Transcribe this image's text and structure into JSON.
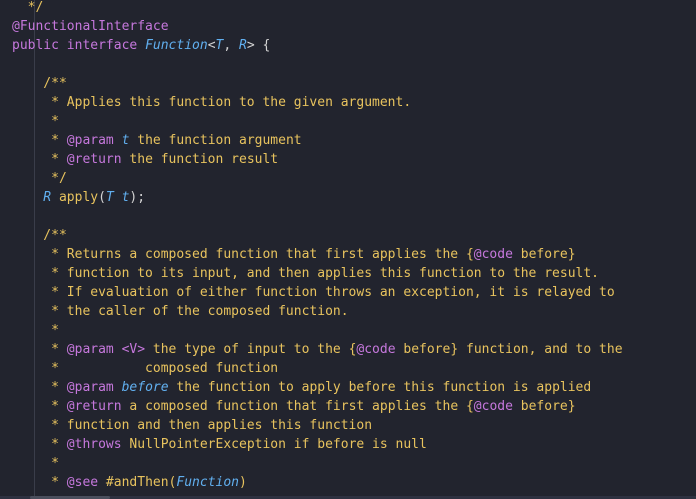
{
  "lines": [
    {
      "segs": [
        {
          "c": "comment",
          "t": "  */"
        }
      ]
    },
    {
      "segs": [
        {
          "c": "anno",
          "t": "@FunctionalInterface"
        }
      ]
    },
    {
      "segs": [
        {
          "c": "kw",
          "t": "public interface "
        },
        {
          "c": "cls",
          "t": "Function"
        },
        {
          "c": "punct",
          "t": "<"
        },
        {
          "c": "tparam",
          "t": "T"
        },
        {
          "c": "punct",
          "t": ", "
        },
        {
          "c": "tparam",
          "t": "R"
        },
        {
          "c": "punct",
          "t": "> {"
        }
      ]
    },
    {
      "segs": []
    },
    {
      "segs": [
        {
          "c": "comment",
          "t": "    /**"
        }
      ]
    },
    {
      "segs": [
        {
          "c": "comment",
          "t": "     * Applies this function to the given argument."
        }
      ]
    },
    {
      "segs": [
        {
          "c": "comment",
          "t": "     *"
        }
      ]
    },
    {
      "segs": [
        {
          "c": "comment",
          "t": "     * "
        },
        {
          "c": "tag",
          "t": "@param"
        },
        {
          "c": "comment",
          "t": " "
        },
        {
          "c": "tparam",
          "t": "t"
        },
        {
          "c": "comment",
          "t": " the function argument"
        }
      ]
    },
    {
      "segs": [
        {
          "c": "comment",
          "t": "     * "
        },
        {
          "c": "tag",
          "t": "@return"
        },
        {
          "c": "comment",
          "t": " the function result"
        }
      ]
    },
    {
      "segs": [
        {
          "c": "comment",
          "t": "     */"
        }
      ]
    },
    {
      "segs": [
        {
          "c": "tparam",
          "t": "    R"
        },
        {
          "c": "method",
          "t": " apply"
        },
        {
          "c": "punct",
          "t": "("
        },
        {
          "c": "tparam",
          "t": "T t"
        },
        {
          "c": "punct",
          "t": ");"
        }
      ]
    },
    {
      "segs": []
    },
    {
      "segs": [
        {
          "c": "comment",
          "t": "    /**"
        }
      ]
    },
    {
      "segs": [
        {
          "c": "comment",
          "t": "     * Returns a composed function that first applies the {"
        },
        {
          "c": "tag",
          "t": "@code"
        },
        {
          "c": "comment",
          "t": " before}"
        }
      ]
    },
    {
      "segs": [
        {
          "c": "comment",
          "t": "     * function to its input, and then applies this function to the result."
        }
      ]
    },
    {
      "segs": [
        {
          "c": "comment",
          "t": "     * If evaluation of either function throws an exception, it is relayed to"
        }
      ]
    },
    {
      "segs": [
        {
          "c": "comment",
          "t": "     * the caller of the composed function."
        }
      ]
    },
    {
      "segs": [
        {
          "c": "comment",
          "t": "     *"
        }
      ]
    },
    {
      "segs": [
        {
          "c": "comment",
          "t": "     * "
        },
        {
          "c": "tag",
          "t": "@param"
        },
        {
          "c": "comment",
          "t": " "
        },
        {
          "c": "tag",
          "t": "<V>"
        },
        {
          "c": "comment",
          "t": " the type of input to the {"
        },
        {
          "c": "tag",
          "t": "@code"
        },
        {
          "c": "comment",
          "t": " before} function, and to the"
        }
      ]
    },
    {
      "segs": [
        {
          "c": "comment",
          "t": "     *           composed function"
        }
      ]
    },
    {
      "segs": [
        {
          "c": "comment",
          "t": "     * "
        },
        {
          "c": "tag",
          "t": "@param"
        },
        {
          "c": "comment",
          "t": " "
        },
        {
          "c": "tparam",
          "t": "before"
        },
        {
          "c": "comment",
          "t": " the function to apply before this function is applied"
        }
      ]
    },
    {
      "segs": [
        {
          "c": "comment",
          "t": "     * "
        },
        {
          "c": "tag",
          "t": "@return"
        },
        {
          "c": "comment",
          "t": " a composed function that first applies the {"
        },
        {
          "c": "tag",
          "t": "@code"
        },
        {
          "c": "comment",
          "t": " before}"
        }
      ]
    },
    {
      "segs": [
        {
          "c": "comment",
          "t": "     * function and then applies this function"
        }
      ]
    },
    {
      "segs": [
        {
          "c": "comment",
          "t": "     * "
        },
        {
          "c": "tag",
          "t": "@throws"
        },
        {
          "c": "comment",
          "t": " NullPointerException if before is null"
        }
      ]
    },
    {
      "segs": [
        {
          "c": "comment",
          "t": "     *"
        }
      ]
    },
    {
      "segs": [
        {
          "c": "comment",
          "t": "     * "
        },
        {
          "c": "tag",
          "t": "@see"
        },
        {
          "c": "comment",
          "t": " #andThen("
        },
        {
          "c": "tparam",
          "t": "Function"
        },
        {
          "c": "comment",
          "t": ")"
        }
      ]
    }
  ],
  "colors": {
    "background": "#22242e",
    "comment": "#e8c35e",
    "keyword": "#c678dd",
    "type": "#61afef"
  }
}
